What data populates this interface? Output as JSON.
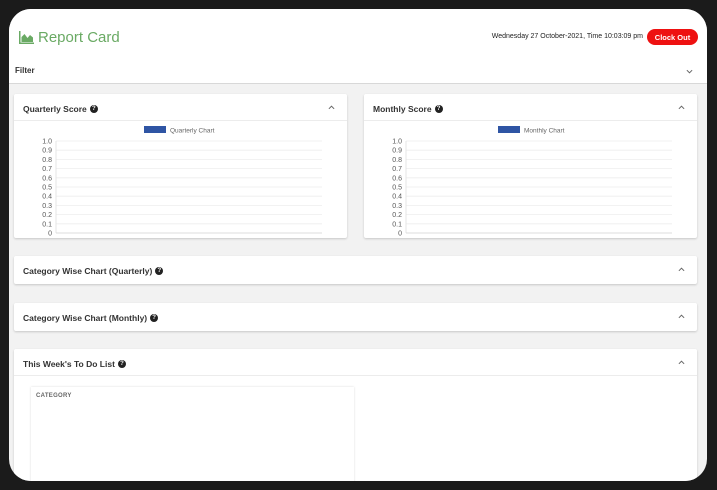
{
  "header": {
    "title": "Report Card",
    "datetime": "Wednesday 27 October-2021, Time 10:03:09 pm",
    "clock_out_label": "Clock Out",
    "brand_color": "#6aaa64",
    "clock_out_color": "#ee1111"
  },
  "filter": {
    "label": "Filter"
  },
  "cards": {
    "quarterly": {
      "title": "Quarterly Score",
      "help_icon": "question-circle-icon"
    },
    "monthly": {
      "title": "Monthly Score",
      "help_icon": "question-circle-icon"
    },
    "category_quarterly": {
      "title": "Category Wise Chart (Quarterly)"
    },
    "category_monthly": {
      "title": "Category Wise Chart (Monthly)"
    },
    "todo": {
      "title": "This Week's To Do List",
      "column_header": "CATEGORY"
    }
  },
  "chart_data": [
    {
      "type": "bar",
      "legend": [
        "Quarterly Chart"
      ],
      "legend_placement": "top-center",
      "series": [
        {
          "name": "Quarterly Chart",
          "values": [],
          "color": "#2f55a4"
        }
      ],
      "yticks": [
        "1.0",
        "0.9",
        "0.8",
        "0.7",
        "0.6",
        "0.5",
        "0.4",
        "0.3",
        "0.2",
        "0.1",
        "0"
      ],
      "ylim": [
        0,
        1.0
      ],
      "grid": true
    },
    {
      "type": "bar",
      "legend": [
        "Monthly Chart"
      ],
      "legend_placement": "top-center",
      "series": [
        {
          "name": "Monthly Chart",
          "values": [],
          "color": "#2f55a4"
        }
      ],
      "yticks": [
        "1.0",
        "0.9",
        "0.8",
        "0.7",
        "0.6",
        "0.5",
        "0.4",
        "0.3",
        "0.2",
        "0.1",
        "0"
      ],
      "ylim": [
        0,
        1.0
      ],
      "grid": true
    }
  ]
}
